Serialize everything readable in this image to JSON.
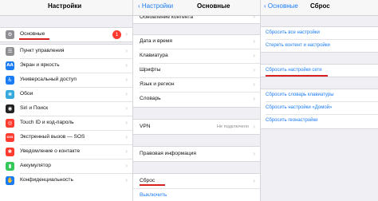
{
  "panel1": {
    "title": "Настройки",
    "items": [
      {
        "label": "Основные",
        "icon": "gear-icon",
        "color": "#8e8e93",
        "glyph": "⚙",
        "badge": "1"
      },
      {
        "label": "Пункт управления",
        "icon": "control-center-icon",
        "color": "#8e8e93",
        "glyph": "☰"
      },
      {
        "label": "Экран и яркость",
        "icon": "display-icon",
        "color": "#1a7cf5",
        "glyph": "AA"
      },
      {
        "label": "Универсальный доступ",
        "icon": "accessibility-icon",
        "color": "#1a7cf5",
        "glyph": "♿"
      },
      {
        "label": "Обои",
        "icon": "wallpaper-icon",
        "color": "#34aadc",
        "glyph": "❀"
      },
      {
        "label": "Siri и Поиск",
        "icon": "siri-icon",
        "color": "#222222",
        "glyph": "◉"
      },
      {
        "label": "Touch ID и код-пароль",
        "icon": "fingerprint-icon",
        "color": "#ff3b30",
        "glyph": "◎"
      },
      {
        "label": "Экстренный вызов — SOS",
        "icon": "sos-icon",
        "color": "#ff3b30",
        "glyph": "SOS"
      },
      {
        "label": "Уведомление о контакте",
        "icon": "exposure-icon",
        "color": "#ff3b30",
        "glyph": "✱"
      },
      {
        "label": "Аккумулятор",
        "icon": "battery-icon",
        "color": "#34c759",
        "glyph": "▮"
      },
      {
        "label": "Конфиденциальность",
        "icon": "privacy-icon",
        "color": "#1a7cf5",
        "glyph": "✋"
      }
    ]
  },
  "panel2": {
    "back": "Настройки",
    "title": "Основные",
    "top_item": "Обновление контента",
    "group1": [
      "Дата и время",
      "Клавиатура",
      "Шрифты",
      "Язык и регион",
      "Словарь"
    ],
    "vpn": {
      "label": "VPN",
      "value": "Не подключено"
    },
    "legal": "Правовая информация",
    "reset": "Сброс",
    "shutdown": "Выключить"
  },
  "panel3": {
    "back": "Основные",
    "title": "Сброс",
    "group1": [
      "Сбросить все настройки",
      "Стереть контент и настройки"
    ],
    "network": "Сбросить настройки сети",
    "group3": [
      "Сбросить словарь клавиатуры",
      "Сбросить настройки «Домой»",
      "Сбросить геонастройки"
    ]
  },
  "colors": {
    "accent": "#1a7cf5",
    "highlight": "#d92121"
  }
}
